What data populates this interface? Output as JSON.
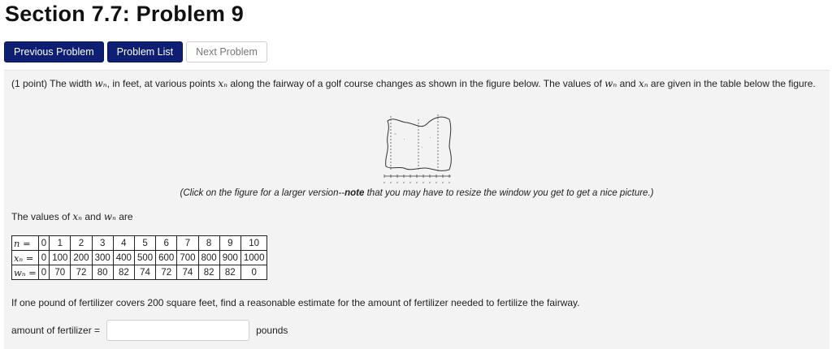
{
  "page": {
    "title": "Section 7.7: Problem 9"
  },
  "nav": {
    "previous_label": "Previous Problem",
    "list_label": "Problem List",
    "next_label": "Next Problem"
  },
  "problem": {
    "points": "(1 point)",
    "intro_1": " The width ",
    "w_symbol": "wₙ",
    "intro_2": ", in feet, at various points ",
    "x_symbol": "xₙ",
    "intro_3": " along the fairway of a golf course changes as shown in the figure below. The values of ",
    "intro_4": " and ",
    "intro_5": " are given in the table below the figure.",
    "caption_1": "(Click on the figure for a larger version--",
    "caption_note": "note",
    "caption_2": " that you may have to resize the window you get to get a nice picture.)",
    "values_1": "The values of ",
    "values_2": " and ",
    "values_3": " are",
    "question": "If one pound of fertilizer covers 200 square feet, find a reasonable estimate for the amount of fertilizer needed to fertilize the fairway.",
    "answer_label": "amount of fertilizer =",
    "answer_value": "",
    "answer_units": "pounds"
  },
  "table": {
    "n_label": "n =",
    "x_label": "xₙ =",
    "w_label": "wₙ =",
    "n": [
      "0",
      "1",
      "2",
      "3",
      "4",
      "5",
      "6",
      "7",
      "8",
      "9",
      "10"
    ],
    "x": [
      "0",
      "100",
      "200",
      "300",
      "400",
      "500",
      "600",
      "700",
      "800",
      "900",
      "1000"
    ],
    "w": [
      "0",
      "70",
      "72",
      "80",
      "82",
      "74",
      "72",
      "74",
      "82",
      "82",
      "0"
    ]
  },
  "colors": {
    "primary_button": "#0d1e73",
    "panel_background": "#f3f3f3"
  }
}
